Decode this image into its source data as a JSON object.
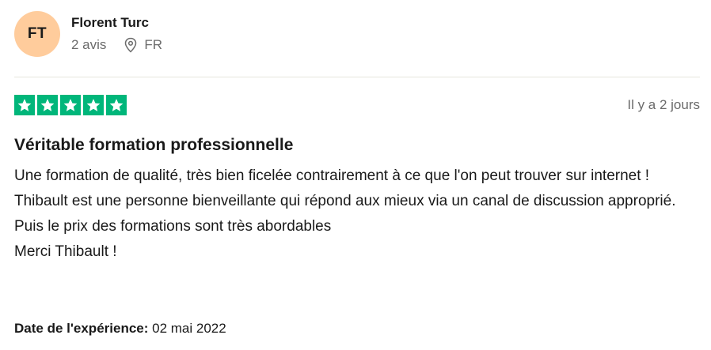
{
  "reviewer": {
    "initials": "FT",
    "name": "Florent Turc",
    "review_count": "2 avis",
    "country": "FR",
    "avatar_color": "#ffcc9c"
  },
  "rating": {
    "stars": 5,
    "max_stars": 5,
    "star_color": "#00b67a",
    "posted": "Il y a 2 jours"
  },
  "review": {
    "title": "Véritable formation professionnelle",
    "lines": [
      "Une formation de qualité, très bien ficelée contrairement à ce que l'on peut trouver sur internet !",
      "Thibault est une personne bienveillante qui répond aux mieux via un canal de discussion approprié.",
      "Puis le prix des formations sont très abordables",
      "Merci Thibault !"
    ],
    "experience_label": "Date de l'expérience:",
    "experience_date": "02 mai 2022"
  }
}
